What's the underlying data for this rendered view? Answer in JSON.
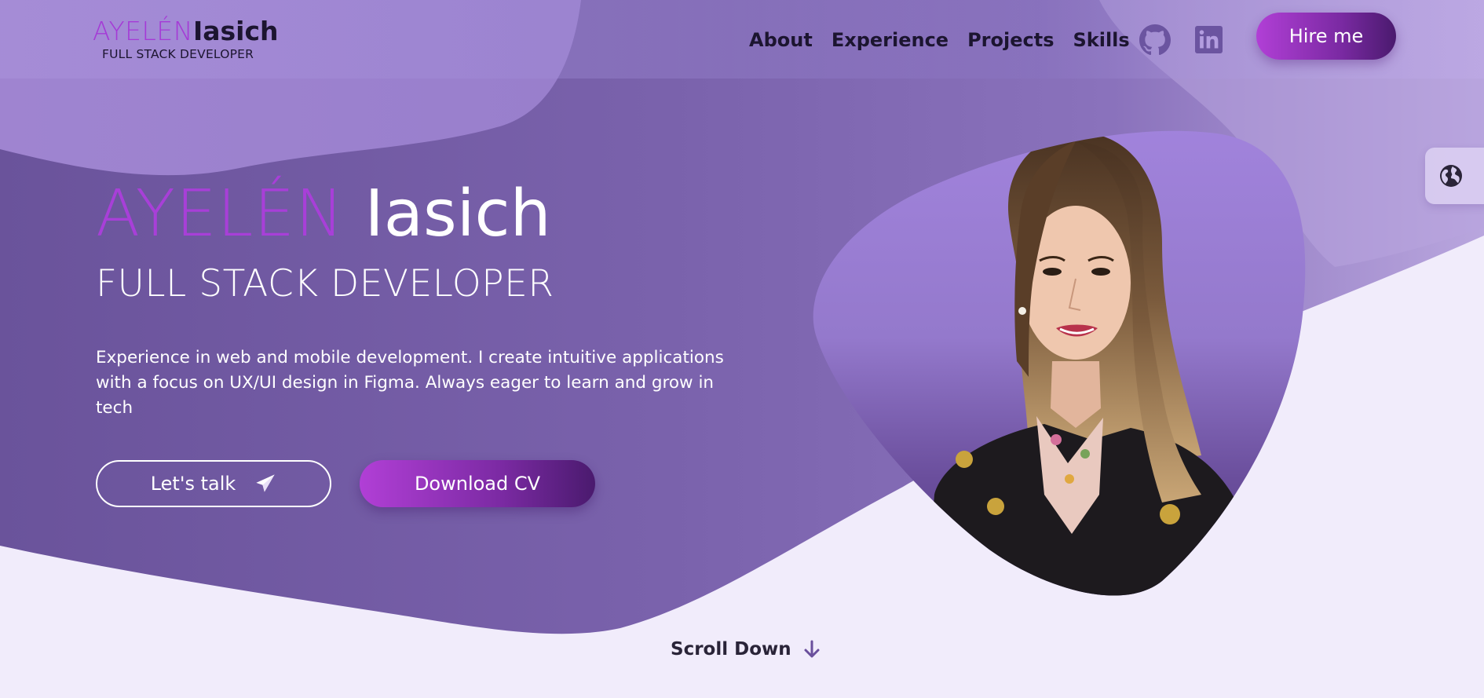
{
  "header": {
    "logo": {
      "first_name": "AYELÉN",
      "last_name": "Iasich",
      "subtitle": "FULL STACK DEVELOPER"
    },
    "nav": [
      {
        "label": "About"
      },
      {
        "label": "Experience"
      },
      {
        "label": "Projects"
      },
      {
        "label": "Skills"
      }
    ],
    "social_icons": [
      "github-icon",
      "linkedin-icon"
    ],
    "hire_button": "Hire me"
  },
  "language_toggle_icon": "globe-icon",
  "hero": {
    "first_name": "AYELÉN",
    "last_name": "Iasich",
    "role": "FULL STACK DEVELOPER",
    "description": "Experience in web and mobile development. I create intuitive applications with a focus on UX/UI design in Figma. Always eager to learn and grow in tech",
    "talk_button": "Let's talk",
    "cv_button": "Download CV"
  },
  "scroll_down": "Scroll Down",
  "colors": {
    "accent": "#a83fd8",
    "hero_bg": "#7a5fab",
    "page_bg": "#f1ecfb",
    "button_gradient_start": "#b13fd6",
    "button_gradient_end": "#4a1a6e"
  }
}
